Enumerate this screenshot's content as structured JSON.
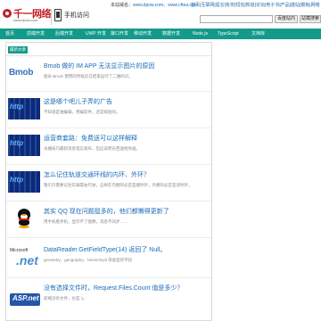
{
  "header": {
    "logo_name": "千一网络",
    "logo_sub": "www.itpow.com",
    "mobile_label": "手机访问",
    "site_label": "本站域名：",
    "site_url1": "www.itpow.com",
    "site_sep": "、",
    "site_url2": "www.cftea.com",
    "quick_links": [
      "首页",
      "互联网",
      "留言",
      "有奖",
      "短信",
      "知道",
      "论坛",
      "电子书",
      "产品",
      "建站",
      "模板",
      "网络"
    ],
    "search_placeholder": "",
    "search_button": "百度站内",
    "search_button2": "站模搜索"
  },
  "nav": {
    "items": [
      "首页",
      "前端开发",
      "后端开发",
      "UWP 开发",
      "接口开发",
      "移动开发",
      "数据开发",
      "Node.js",
      "TypeScript",
      "文档库"
    ]
  },
  "section_tag": "最新文章",
  "articles": [
    {
      "thumb": "bmob-logo",
      "thumb_text": "Bmob",
      "title": "Bmob 做的 IM APP 无法显示图片的原因",
      "desc": "图米 Bmob 使用的时候云已结束运行了二维码识。"
    },
    {
      "thumb": "http-logo",
      "thumb_text": "http",
      "title": "这是哪个吧儿子弄的广告",
      "desc": "不知道是谁编辑，用编软件，还是搞短的。"
    },
    {
      "thumb": "http-logo",
      "thumb_text": "http",
      "title": "运营商套路：免费送可以这样解释",
      "desc": "光播技巧最新消息电信发布，但这说把东西送给你送。"
    },
    {
      "thumb": "http-logo",
      "thumb_text": "http",
      "title": "怎么记住轨道交通环线的内环、外环？",
      "desc": "我们只需要记住车辆靠右行驶，这样在内圈的必定是顺时针，外圈的必定是逆时针。"
    },
    {
      "thumb": "qq-penguin",
      "thumb_text": "",
      "title": "其实 QQ 现在问题挺多的，他们都懒得更新了",
      "desc": "用手机看手机，显示不了图像，消息不同步……"
    },
    {
      "thumb": "dotnet-logo",
      "thumb_text": ".net",
      "title": "DataReader.GetFieldType(14) 返回了 Null。",
      "desc": "geometry、geography、hierarchyid 等类型的字段"
    },
    {
      "thumb": "aspnet-logo",
      "thumb_text": "ASP.net",
      "title": "没有选择文件时，Request.Files.Count 值是多少？",
      "desc": "前端没有文件，也是 1。"
    }
  ],
  "colors": {
    "accent": "#139a8b",
    "link": "#1a6bb8",
    "brand": "#c0202a"
  }
}
